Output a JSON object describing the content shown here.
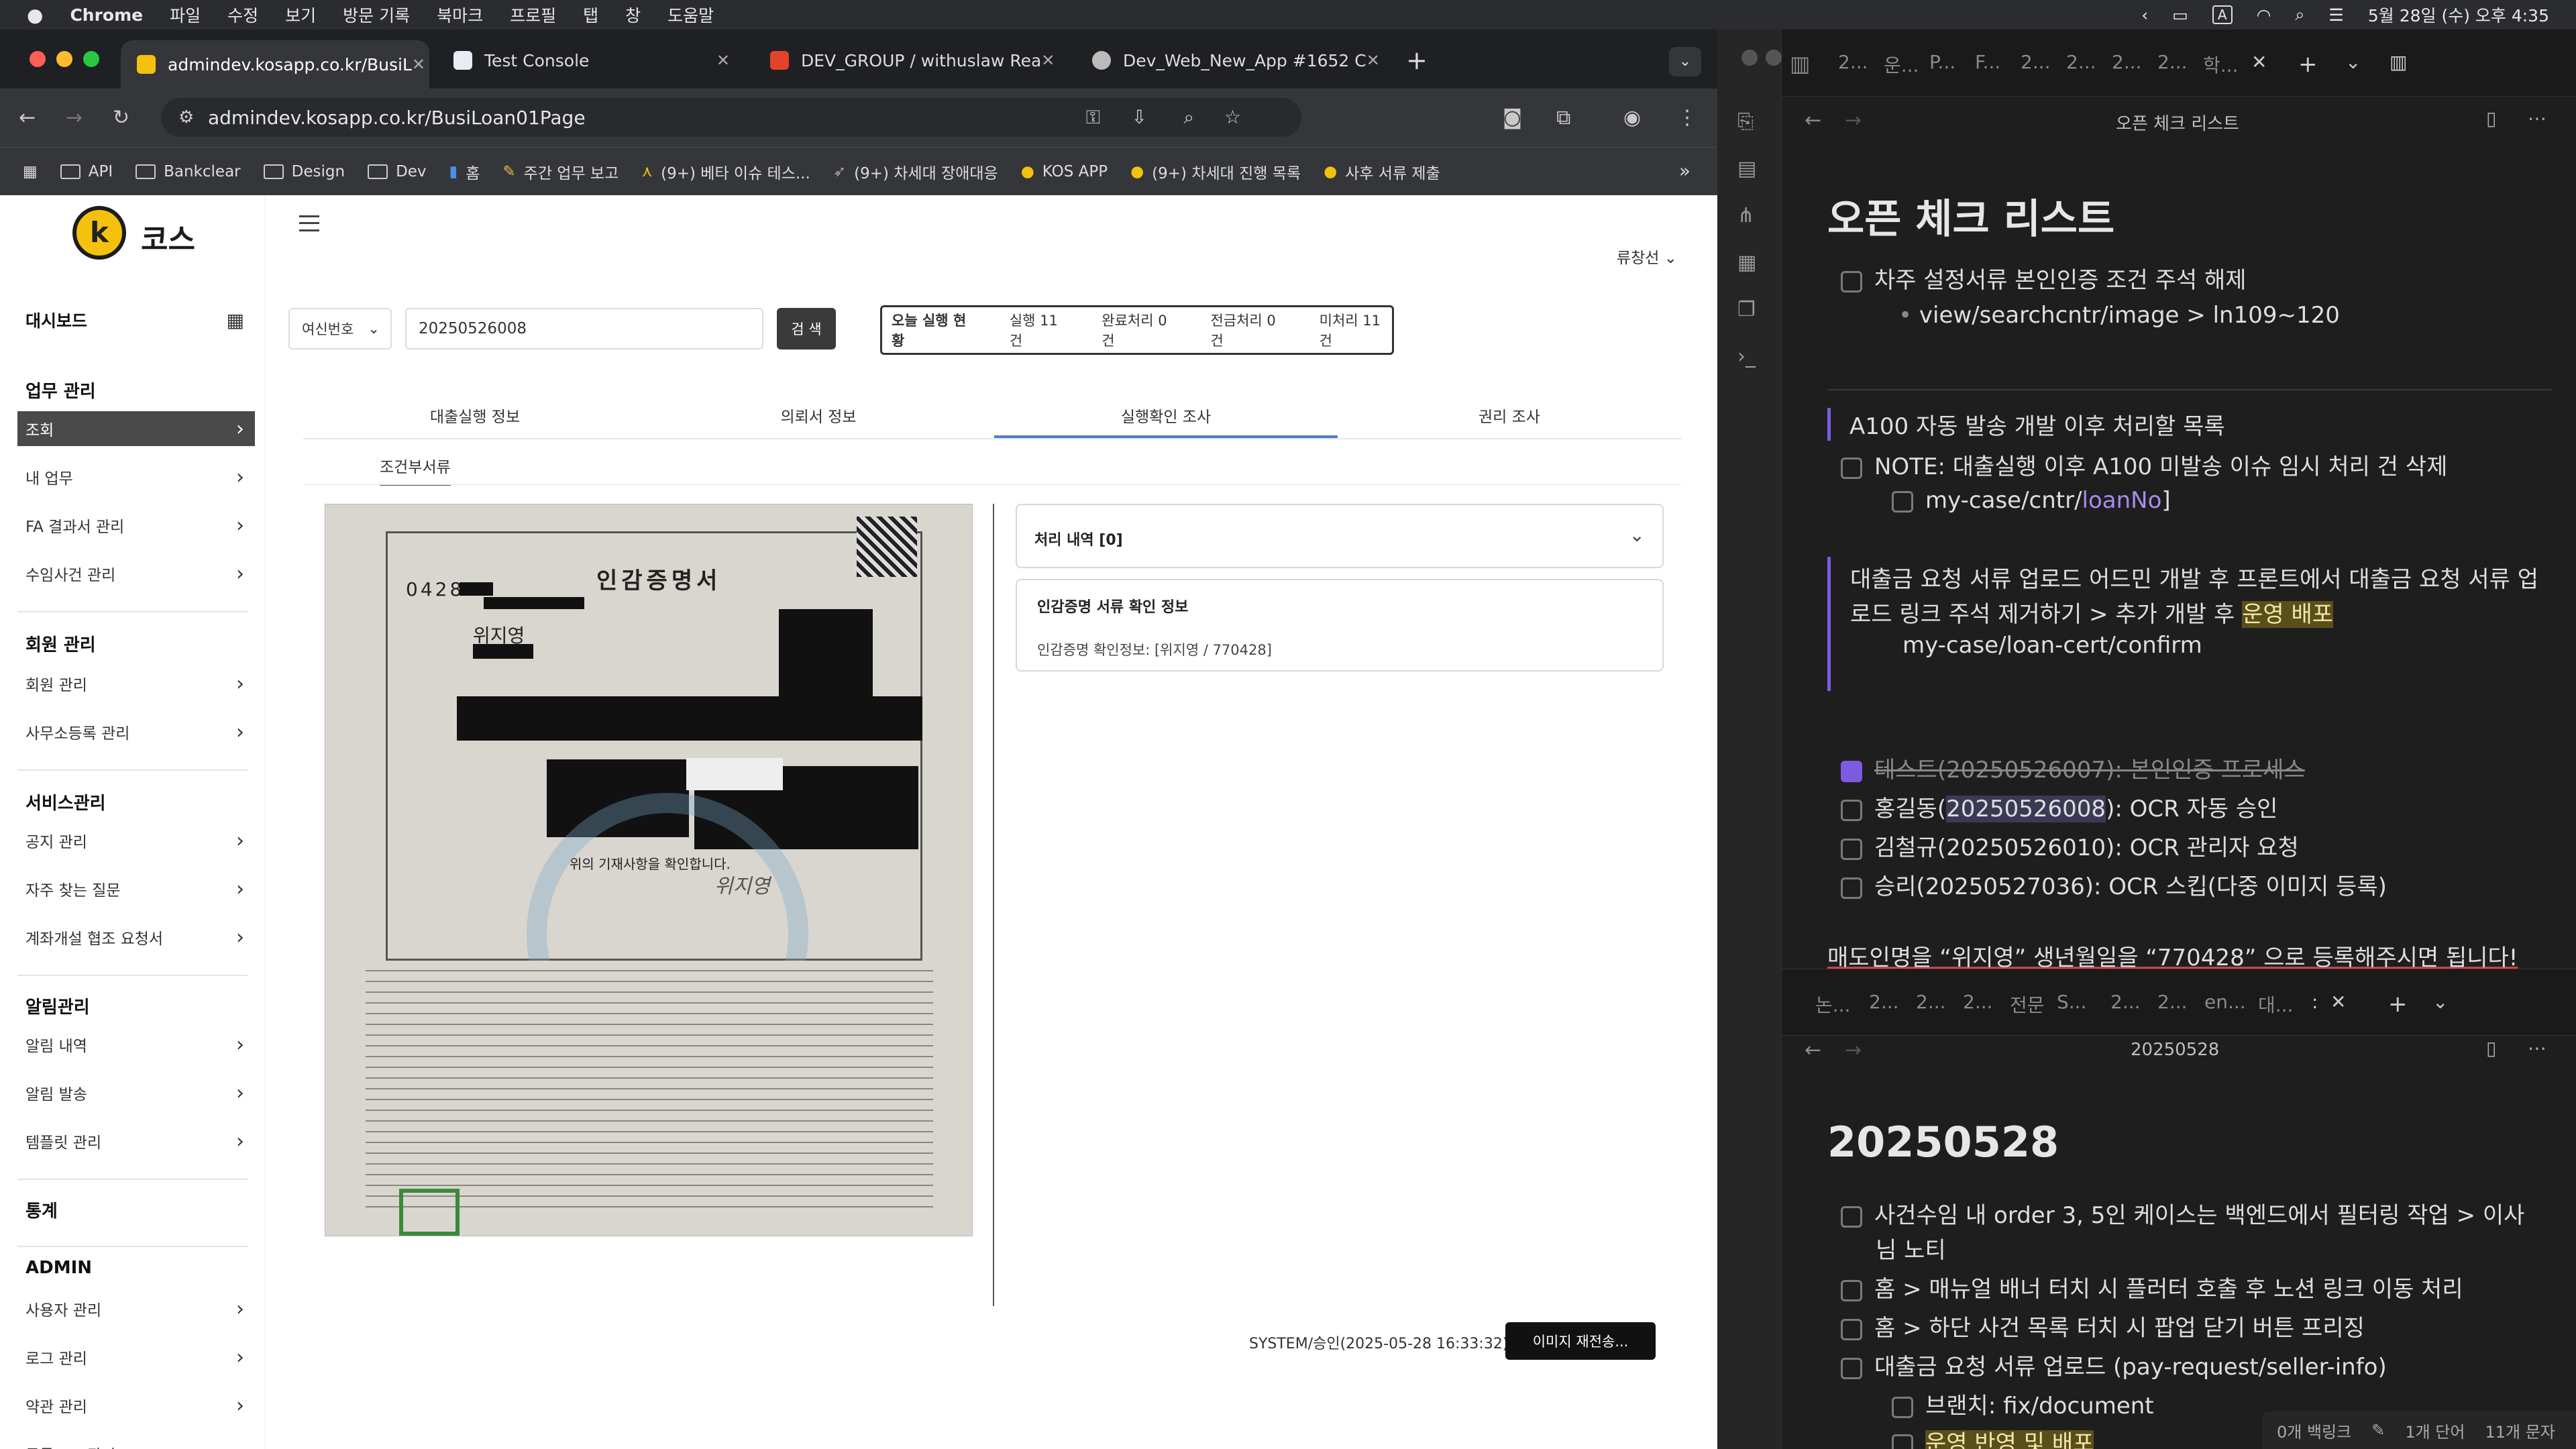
{
  "menubar": {
    "app": "Chrome",
    "items": [
      "파일",
      "수정",
      "보기",
      "방문 기록",
      "북마크",
      "프로필",
      "탭",
      "창",
      "도움말"
    ],
    "ime": "A",
    "clock": "5월 28일 (수) 오후 4:35"
  },
  "chrome": {
    "tabs": [
      {
        "title": "admindev.kosapp.co.kr/BusiL"
      },
      {
        "title": "Test Console"
      },
      {
        "title": "DEV_GROUP / withuslaw Rea"
      },
      {
        "title": "Dev_Web_New_App #1652 C"
      }
    ],
    "url": "admindev.kosapp.co.kr/BusiLoan01Page",
    "bookmarks": [
      "API",
      "Bankclear",
      "Design",
      "Dev",
      "홈",
      "주간 업무 보고",
      "(9+) 베타 이슈 테스...",
      "(9+) 차세대 장애대응",
      "KOS APP",
      "(9+) 차세대 진행 목록",
      "사후 서류 제출"
    ]
  },
  "sidebar": {
    "logo_letter": "k",
    "logo_text": "코스",
    "dashboard": "대시보드",
    "groups": [
      {
        "title": "업무 관리",
        "items": [
          "조회",
          "내 업무",
          "FA 결과서 관리",
          "수임사건 관리"
        ]
      },
      {
        "title": "회원 관리",
        "items": [
          "회원 관리",
          "사무소등록 관리"
        ]
      },
      {
        "title": "서비스관리",
        "items": [
          "공지 관리",
          "자주 찾는 질문",
          "계좌개설 협조 요청서"
        ]
      },
      {
        "title": "알림관리",
        "items": [
          "알림 내역",
          "알림 발송",
          "템플릿 관리"
        ]
      },
      {
        "title": "통계",
        "items": []
      },
      {
        "title": "ADMIN",
        "items": [
          "사용자 관리",
          "로그 관리",
          "약관 관리",
          "공통코드 관리"
        ]
      }
    ]
  },
  "content": {
    "user": "류창선",
    "search": {
      "select": "여신번호",
      "value": "20250526008",
      "button": "검 색"
    },
    "status": {
      "label": "오늘 실행 현황",
      "items": [
        "실행 11건",
        "완료처리 0건",
        "전금처리 0건",
        "미처리 11건"
      ]
    },
    "tabs": [
      "대출실행 정보",
      "의뢰서 정보",
      "실행확인 조사",
      "권리 조사"
    ],
    "subtab": "조건부서류",
    "doc": {
      "title": "인감증명서",
      "name": "위지영",
      "number": "0428-",
      "confirm": "위의 기재사항을 확인합니다.",
      "sign": "위지영"
    },
    "history": "처리 내역 [0]",
    "info_title": "인감증명 서류 확인 정보",
    "info_text": "인감증명 확인정보: [위지영 / 770428]",
    "footer_status": "SYSTEM/승인(2025-05-28 16:33:32)",
    "resend": "이미지 재전송..."
  },
  "obsidian": {
    "top_tabs": [
      "2...",
      "운...",
      "P...",
      "F...",
      "2...",
      "2...",
      "2...",
      "2...",
      "학..."
    ],
    "note1": {
      "title": "오픈 체크 리스트",
      "heading": "오픈 체크 리스트",
      "lines": [
        "차주 설정서류 본인인증 조건 주석 해제",
        "view/searchcntr/image > ln109~120",
        "A100 자동 발송 개발 이후 처리할 목록",
        "NOTE: 대출실행 이후 A100 미발송 이슈 임시 처리 건 삭제",
        "my-case/cntr/",
        "loanNo",
        "대출금 요청 서류 업로드 어드민 개발 후 프론트에서 대출금 요청 서류 업",
        "로드 링크 주석 제거하기 > 추가 개발 후 ",
        "운영 배포",
        "my-case/loan-cert/confirm",
        "테스트(20250526007): 본인인증 프로세스",
        "홍길동(",
        "20250526008",
        "): OCR 자동 승인",
        "김철규(20250526010): OCR 관리자 요청",
        "승리(20250527036): OCR 스킵(다중 이미지 등록)",
        "매도인명을 “위지영” 생년월일을 “770428” 으로 등록해주시면 됩니다!"
      ]
    },
    "bottom_tabs": [
      "논...",
      "2...",
      "2...",
      "2...",
      "전문",
      "S...",
      "2...",
      "2...",
      "en...",
      "대...",
      ":"
    ],
    "note2": {
      "title": "20250528",
      "heading": "20250528",
      "lines": [
        "사건수임 내 order 3, 5인 케이스는 백엔드에서 필터링 작업 > 이사",
        "님 노티",
        "홈 > 매뉴얼 배너 터치 시 플러터 호출 후 노션 링크 이동 처리",
        "홈 > 하단 사건 목록 터치 시 팝업 닫기 버튼 프리징",
        "대출금 요청 서류 업로드 (pay-request/seller-info)",
        "브랜치: fix/document",
        "운영 반영 및 배포"
      ]
    },
    "status": [
      "0개 백링크",
      "1개 단어",
      "11개 문자"
    ]
  },
  "colors": {
    "accent": "#7c5be0",
    "tab_underline": "#4f7ccf",
    "logo": "#f4c20d"
  }
}
